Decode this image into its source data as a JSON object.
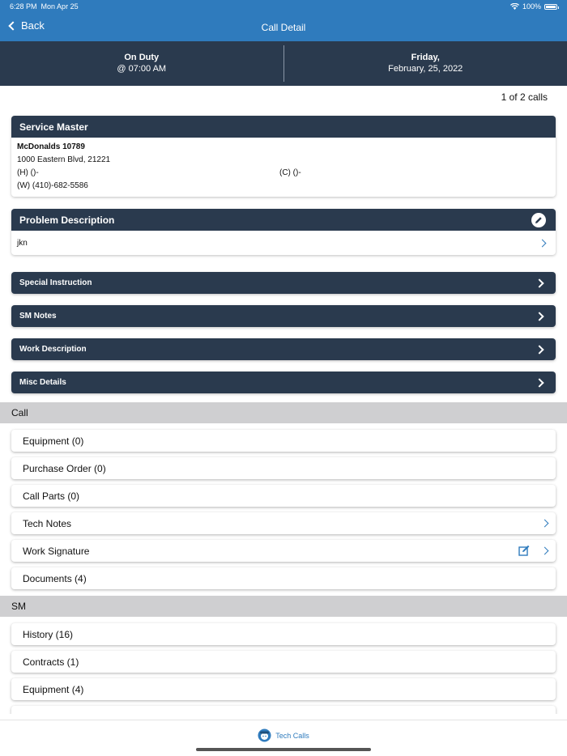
{
  "status": {
    "time": "6:28 PM",
    "date": "Mon Apr 25",
    "battery": "100%"
  },
  "nav": {
    "back_label": "Back",
    "title": "Call Detail"
  },
  "duty": {
    "status": "On Duty",
    "time": "@ 07:00 AM",
    "day": "Friday,",
    "date": "February, 25, 2022"
  },
  "calls_count": "1 of 2 calls",
  "service_master": {
    "title": "Service Master",
    "name": "McDonalds 10789",
    "address": "1000 Eastern Blvd, 21221",
    "home_phone": "(H) ()-",
    "cell_phone": "(C) ()-",
    "work_phone": "(W) (410)-682-5586"
  },
  "problem": {
    "title": "Problem Description",
    "text": "jkn"
  },
  "collapsed_sections": [
    {
      "label": "Special Instruction"
    },
    {
      "label": "SM Notes"
    },
    {
      "label": "Work Description"
    },
    {
      "label": "Misc Details"
    }
  ],
  "call_section": {
    "title": "Call",
    "items": [
      {
        "label": "Equipment (0)"
      },
      {
        "label": "Purchase Order (0)"
      },
      {
        "label": "Call Parts (0)"
      },
      {
        "label": "Tech Notes"
      },
      {
        "label": "Work Signature"
      },
      {
        "label": "Documents (4)"
      }
    ]
  },
  "sm_section": {
    "title": "SM",
    "items": [
      {
        "label": "History (16)"
      },
      {
        "label": "Contracts (1)"
      },
      {
        "label": "Equipment (4)"
      }
    ]
  },
  "tabbar": {
    "label": "Tech Calls"
  },
  "colors": {
    "accent": "#2f7bbd",
    "header_dark": "#2a3a4e",
    "section_gray": "#cfcfd1"
  }
}
